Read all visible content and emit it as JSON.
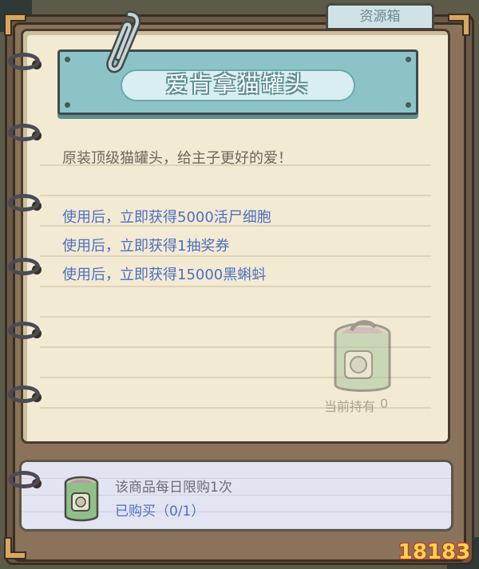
{
  "tab": {
    "label": "资源箱"
  },
  "item": {
    "title": "爱肯拿猫罐头",
    "description": "原装顶级猫罐头，给主子更好的爱！",
    "effects": [
      "使用后，立即获得5000活尸细胞",
      "使用后，立即获得1抽奖券",
      "使用后，立即获得15000黑蝌蚪"
    ],
    "owned_label": "当前持有",
    "owned_count": "0",
    "icon": "cat-food-can-icon"
  },
  "purchase": {
    "limit_text": "该商品每日限购1次",
    "bought_text": "已购买（0/1）"
  },
  "watermark": {
    "text": "18183"
  },
  "colors": {
    "banner": "#8cc3c7",
    "paper": "#f3ead4",
    "effect_text": "#4d6fbf",
    "bottom_panel": "#e3e4f1"
  }
}
